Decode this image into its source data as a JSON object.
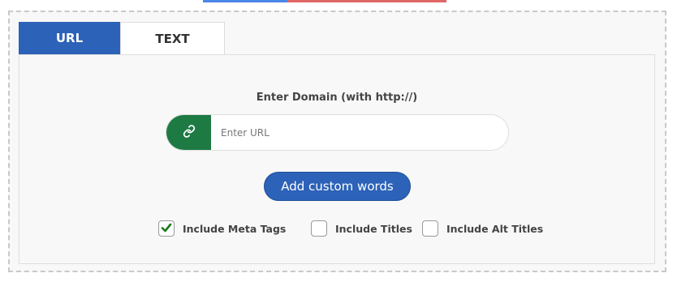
{
  "colors": {
    "primary_blue": "#2c62b8",
    "link_green": "#1d7a43",
    "check_green": "#1a7a1a",
    "top_blue": "#4a86e8",
    "top_red": "#e06666"
  },
  "tabs": [
    {
      "label": "URL",
      "active": true
    },
    {
      "label": "TEXT",
      "active": false
    }
  ],
  "form": {
    "domain_label": "Enter Domain (with http://)",
    "url_placeholder": "Enter URL",
    "url_value": "",
    "link_icon": "link-icon",
    "custom_words_label": "Add custom words"
  },
  "options": [
    {
      "label": "Include Meta Tags",
      "checked": true
    },
    {
      "label": "Include Titles",
      "checked": false
    },
    {
      "label": "Include Alt Titles",
      "checked": false
    }
  ]
}
